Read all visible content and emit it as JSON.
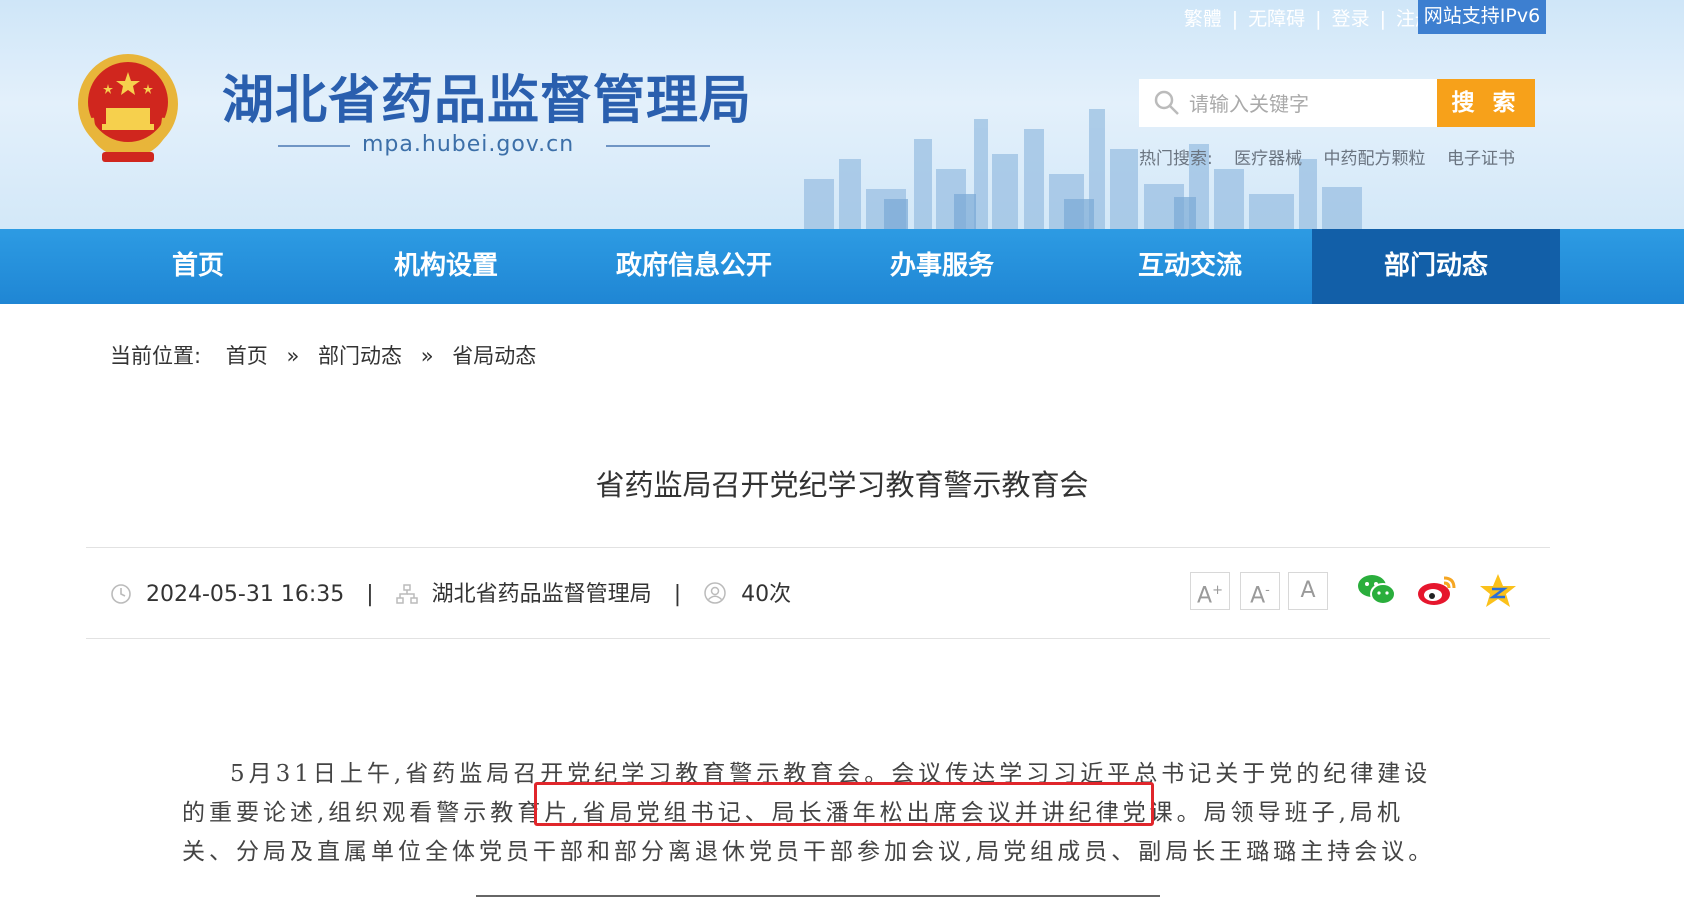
{
  "header": {
    "site_title": "湖北省药品监督管理局",
    "site_domain": "mpa.hubei.gov.cn",
    "top_links": [
      "繁體",
      "无障碍",
      "登录",
      "注册"
    ],
    "ipv6_badge": "网站支持IPv6",
    "search": {
      "placeholder": "请输入关键字",
      "button_label": "搜 索"
    },
    "hot_search": {
      "label": "热门搜索:",
      "items": [
        "医疗器械",
        "中药配方颗粒",
        "电子证书"
      ]
    }
  },
  "nav": {
    "items": [
      {
        "label": "首页"
      },
      {
        "label": "机构设置"
      },
      {
        "label": "政府信息公开"
      },
      {
        "label": "办事服务"
      },
      {
        "label": "互动交流"
      },
      {
        "label": "部门动态"
      }
    ],
    "active": "部门动态"
  },
  "breadcrumb": {
    "prefix": "当前位置:",
    "items": [
      "首页",
      "部门动态",
      "省局动态"
    ],
    "separator": "»"
  },
  "article": {
    "title": "省药监局召开党纪学习教育警示教育会",
    "date": "2024-05-31 16:35",
    "source": "湖北省药品监督管理局",
    "views": "40次",
    "font_size_buttons": [
      "A+",
      "A-",
      "A"
    ],
    "share_icons": [
      "wechat-icon",
      "weibo-icon",
      "qzone-icon"
    ],
    "body_part1": "5月31日上午,省药监局召开党纪学习教育警示教育会。会议传达学习习近平总书记关于党的纪律建设的重要论述,组织观看警示教育片,",
    "body_highlight": "省局党组书记、局长潘年松出席会议并讲纪律党课。",
    "body_part2": "局领导班子,局机关、分局及直属单位全体党员干部和部分离退休党员干部参加会议,局党组成员、副局长王璐璐主持会议。"
  },
  "colors": {
    "brand_blue": "#2a5fae",
    "nav_blue": "#2d9be3",
    "nav_active": "#125fa8",
    "search_orange": "#f7a11a",
    "highlight_red": "#e0262b"
  }
}
